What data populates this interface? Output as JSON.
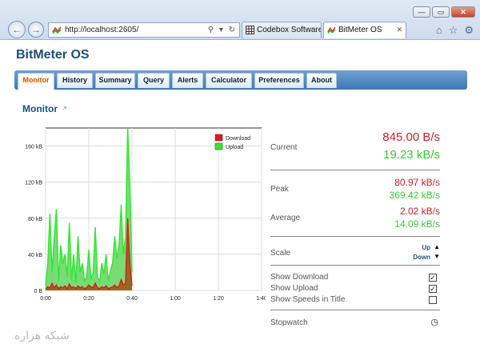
{
  "browser": {
    "address": "http://localhost:2605/",
    "tabs": [
      {
        "label": "Codebox Software ...",
        "active": false
      },
      {
        "label": "BitMeter OS",
        "active": true
      }
    ],
    "window_buttons": {
      "minimize": "—",
      "maximize": "▭",
      "close": "✕"
    }
  },
  "app": {
    "title": "BitMeter OS",
    "nav": [
      "Monitor",
      "History",
      "Summary",
      "Query",
      "Alerts",
      "Calculator",
      "Preferences",
      "About"
    ],
    "active_nav": "Monitor"
  },
  "monitor": {
    "title": "Monitor",
    "popout_icon": "popout-icon"
  },
  "stats": {
    "current_label": "Current",
    "current_download": "845.00 B/s",
    "current_upload": "19.23 kB/s",
    "peak_label": "Peak",
    "peak_download": "80.97 kB/s",
    "peak_upload": "369.42 kB/s",
    "average_label": "Average",
    "average_download": "2.02 kB/s",
    "average_upload": "14.09 kB/s",
    "scale_label": "Scale",
    "scale_up": "Up",
    "scale_down": "Down",
    "show_download_label": "Show Download",
    "show_upload_label": "Show Upload",
    "show_speeds_label": "Show Speeds in Title",
    "show_download": true,
    "show_upload": true,
    "show_speeds": false,
    "stopwatch_label": "Stopwatch"
  },
  "colors": {
    "download": "#e01b1b",
    "upload": "#2ee82e",
    "download_fill": "#9a5a1a",
    "upload_fill": "#5fd65f"
  },
  "watermark": "شبکه هزاره",
  "chart_data": {
    "type": "area",
    "ylim": [
      0,
      180
    ],
    "yticks": [
      "0 B",
      "40 kB",
      "80 kB",
      "120 kB",
      "160 kB"
    ],
    "ytick_values": [
      0,
      40,
      80,
      120,
      160
    ],
    "xticks": [
      "0:00",
      "0:20",
      "0:40",
      "1:00",
      "1:20",
      "1:40"
    ],
    "xtick_values": [
      0,
      20,
      40,
      60,
      80,
      100
    ],
    "xlim": [
      0,
      100
    ],
    "legend_position": "top-right",
    "grid": true,
    "series": [
      {
        "name": "Download",
        "x": [
          0,
          1,
          2,
          3,
          4,
          5,
          6,
          7,
          8,
          9,
          10,
          11,
          12,
          13,
          14,
          15,
          16,
          17,
          18,
          19,
          20,
          21,
          22,
          23,
          24,
          25,
          26,
          27,
          28,
          29,
          30,
          31,
          32,
          33,
          34,
          35,
          36,
          37,
          38,
          39,
          40
        ],
        "values": [
          2,
          4,
          3,
          8,
          3,
          6,
          2,
          4,
          3,
          5,
          2,
          7,
          3,
          4,
          2,
          5,
          3,
          4,
          2,
          3,
          6,
          4,
          3,
          8,
          3,
          2,
          4,
          3,
          5,
          2,
          3,
          4,
          6,
          3,
          5,
          12,
          6,
          8,
          80,
          30,
          5
        ]
      },
      {
        "name": "Upload",
        "x": [
          0,
          1,
          2,
          3,
          4,
          5,
          6,
          7,
          8,
          9,
          10,
          11,
          12,
          13,
          14,
          15,
          16,
          17,
          18,
          19,
          20,
          21,
          22,
          23,
          24,
          25,
          26,
          27,
          28,
          29,
          30,
          31,
          32,
          33,
          34,
          35,
          36,
          37,
          38,
          39,
          40
        ],
        "values": [
          5,
          30,
          85,
          20,
          60,
          90,
          10,
          50,
          30,
          40,
          15,
          75,
          12,
          40,
          8,
          60,
          20,
          30,
          10,
          15,
          45,
          12,
          20,
          70,
          15,
          10,
          30,
          18,
          40,
          10,
          22,
          30,
          60,
          35,
          50,
          95,
          40,
          60,
          200,
          120,
          20
        ]
      }
    ]
  }
}
